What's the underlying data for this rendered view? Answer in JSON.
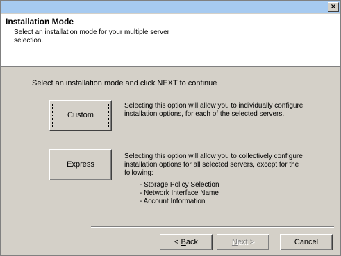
{
  "window": {
    "close_label": "×"
  },
  "header": {
    "title": "Installation Mode",
    "subtitle": "Select an installation mode for your multiple server selection."
  },
  "main": {
    "instruction": "Select an installation mode and click NEXT to continue",
    "modes": [
      {
        "label": "Custom",
        "description": "Selecting this option will allow you to individually configure installation options, for each of the selected servers."
      },
      {
        "label": "Express",
        "description": "Selecting this option will allow you to collectively configure installation options for all selected servers, except for the following:",
        "exceptions": [
          "- Storage Policy Selection",
          "- Network Interface Name",
          "- Account Information"
        ]
      }
    ]
  },
  "footer": {
    "back_prefix": "< ",
    "back_key": "B",
    "back_rest": "ack",
    "next_key": "N",
    "next_rest": "ext >",
    "cancel_label": "Cancel"
  }
}
